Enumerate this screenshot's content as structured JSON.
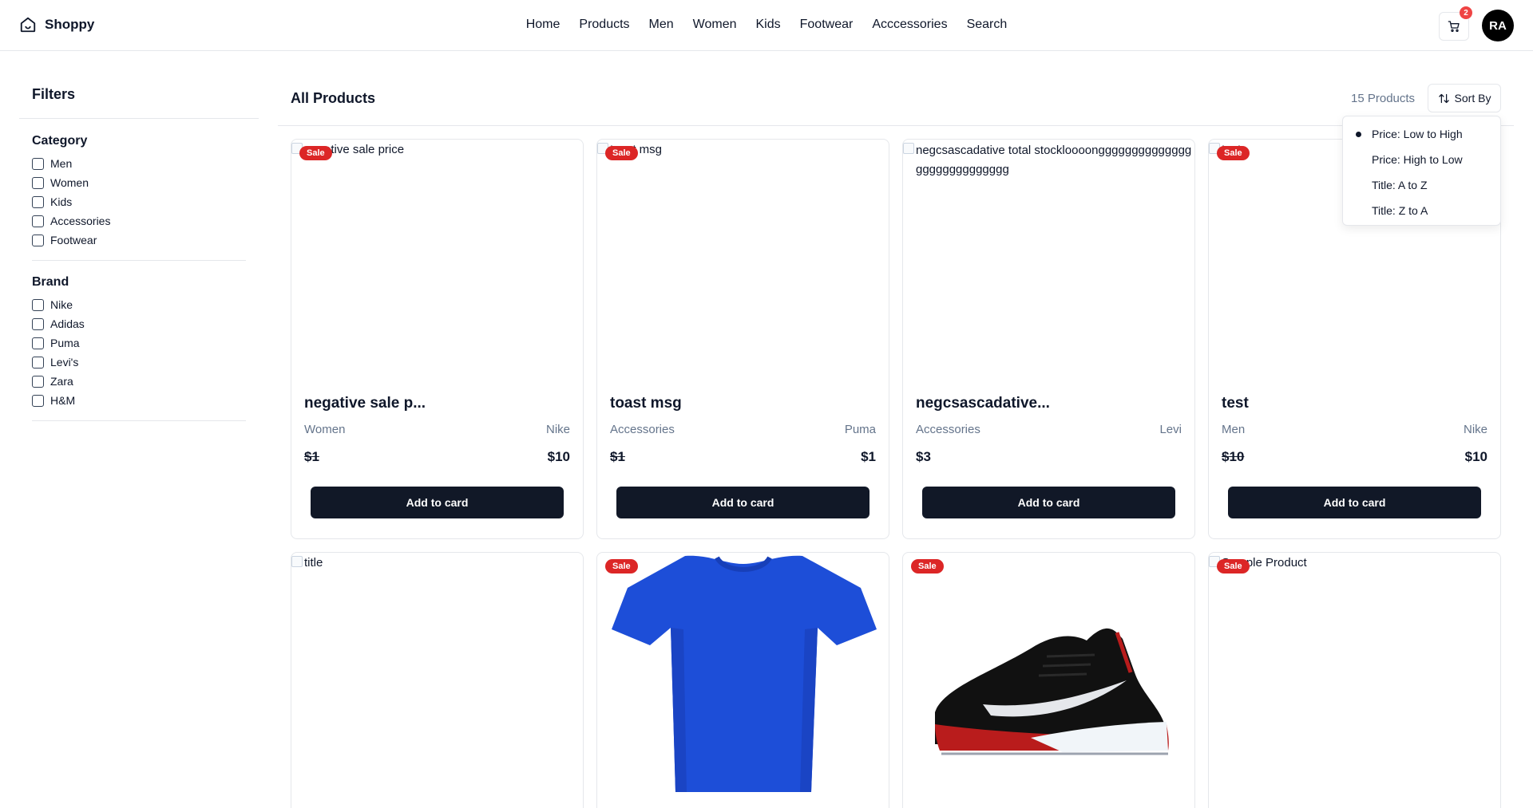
{
  "header": {
    "logo_text": "Shoppy",
    "nav": [
      "Home",
      "Products",
      "Men",
      "Women",
      "Kids",
      "Footwear",
      "Acccessories",
      "Search"
    ],
    "cart_count": "2",
    "avatar_initials": "RA"
  },
  "sidebar": {
    "title": "Filters",
    "category_title": "Category",
    "categories": [
      "Men",
      "Women",
      "Kids",
      "Accessories",
      "Footwear"
    ],
    "brand_title": "Brand",
    "brands": [
      "Nike",
      "Adidas",
      "Puma",
      "Levi's",
      "Zara",
      "H&M"
    ]
  },
  "main": {
    "title": "All Products",
    "count": "15 Products",
    "sort_label": "Sort By",
    "sort_options": [
      "Price: Low to High",
      "Price: High to Low",
      "Title: A to Z",
      "Title: Z to A"
    ],
    "sort_selected": "Price: Low to High",
    "add_label": "Add to card",
    "sale_label": "Sale",
    "products": [
      {
        "alt": "negative sale price",
        "title": "negative sale p...",
        "category": "Women",
        "brand": "Nike",
        "old_price": "$1",
        "price": "$10",
        "sale": true
      },
      {
        "alt": "toast msg",
        "title": "toast msg",
        "category": "Accessories",
        "brand": "Puma",
        "old_price": "$1",
        "price": "$1",
        "sale": true
      },
      {
        "alt": "negcsascadative total stockloooongggggggggggggggggggggggggggg",
        "title": "negcsascadative...",
        "category": "Accessories",
        "brand": "Levi",
        "old_price": "",
        "price": "$3",
        "sale": false
      },
      {
        "alt": "test",
        "title": "test",
        "category": "Men",
        "brand": "Nike",
        "old_price": "$10",
        "price": "$10",
        "sale": true
      },
      {
        "alt": "title",
        "sale": false
      },
      {
        "alt": "",
        "image": "blue-tshirt",
        "sale": true
      },
      {
        "alt": "",
        "image": "sneaker",
        "sale": true
      },
      {
        "alt": "Sample Product",
        "sale": true
      }
    ]
  }
}
